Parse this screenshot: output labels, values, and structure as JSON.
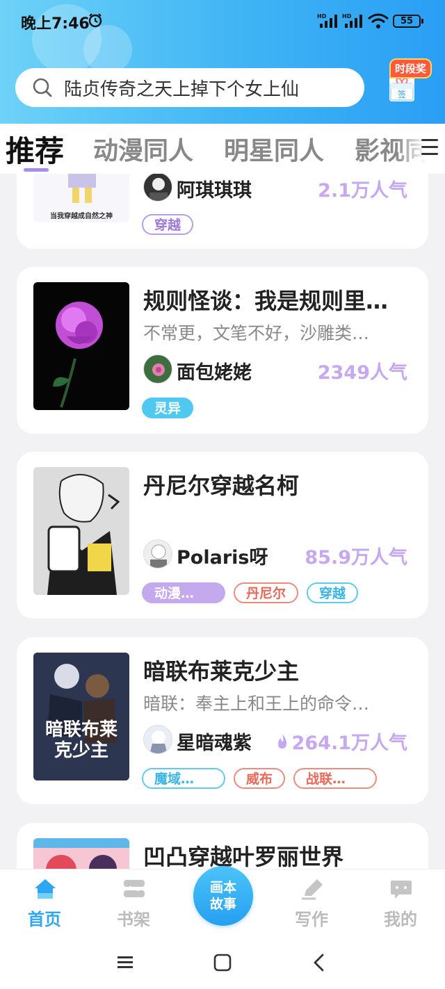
{
  "status_bar": {
    "time": "晚上7:46",
    "signal1": "HD",
    "signal2": "HD",
    "battery": "55"
  },
  "search": {
    "value": "陆贞传奇之天上掉下个女上仙"
  },
  "reward": {
    "badge": "时段奖",
    "gift_label": "签"
  },
  "tabs": [
    {
      "label": "推荐"
    },
    {
      "label": "动漫同人"
    },
    {
      "label": "明星同人"
    },
    {
      "label": "影视同"
    }
  ],
  "cards": [
    {
      "cover_caption": "当我穿越成自然之神",
      "author": "阿琪琪琪",
      "popularity": "2.1万人气",
      "tags": [
        {
          "label": "穿越",
          "style": "purple-outline"
        }
      ]
    },
    {
      "title": "规则怪谈：我是规则里…",
      "desc": "不常更，文笔不好，沙雕类…",
      "author": "面包姥姥",
      "popularity": "2349人气",
      "tags": [
        {
          "label": "灵异",
          "style": "cyan-fill"
        }
      ]
    },
    {
      "title": "丹尼尔穿越名柯",
      "author": "Polaris呀",
      "popularity": "85.9万人气",
      "tags": [
        {
          "label": "动漫…",
          "style": "purple-fill"
        },
        {
          "label": "丹尼尔",
          "style": "red-outline"
        },
        {
          "label": "穿越",
          "style": "cyan-outline"
        }
      ]
    },
    {
      "title": "暗联布莱克少主",
      "desc": "暗联：奉主上和王上的命令…",
      "cover_text": "暗联布莱克少主",
      "author": "星暗魂紫",
      "popularity": "264.1万人气",
      "tags": [
        {
          "label": "魔域…",
          "style": "cyan-outline"
        },
        {
          "label": "威布",
          "style": "red-outline"
        },
        {
          "label": "战联…",
          "style": "red-outline"
        }
      ]
    },
    {
      "title": "凹凸穿越叶罗丽世界"
    }
  ],
  "bottom_nav": {
    "home": "首页",
    "bookshelf": "书架",
    "center_line1": "画本",
    "center_line2": "故事",
    "write": "写作",
    "mine": "我的"
  },
  "colors": {
    "accent": "#2ea6f2",
    "popularity": "#c6a8f2",
    "header": "#3fb4f4"
  }
}
